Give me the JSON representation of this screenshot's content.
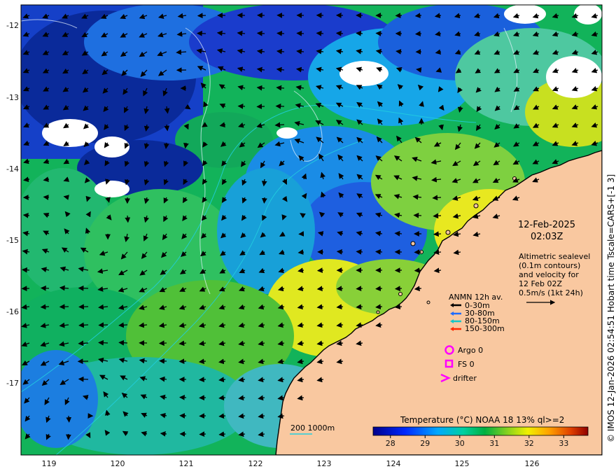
{
  "map": {
    "date": "12-Feb-2025",
    "time": "02:03Z",
    "side_credit": "© IMOS 12-Jan-2026 02:54:51 Hobart time Tscale=CARS+[-1 3]",
    "altimetry_note": [
      "Altimetric sealevel",
      "(0.1m contours)",
      "and velocity for",
      "12 Feb 02Z",
      "0.5m/s (1kt 24h)"
    ],
    "moorings": {
      "title": "ANMN 12h av.",
      "items": [
        {
          "label": "0-30m",
          "color": "#000000"
        },
        {
          "label": "30-80m",
          "color": "#1e6bff"
        },
        {
          "label": "80-150m",
          "color": "#14c8c8"
        },
        {
          "label": "150-300m",
          "color": "#ff2a00"
        }
      ]
    },
    "markers": [
      {
        "label": "Argo 0",
        "symbol": "circle-icon",
        "color": "#ff00ff"
      },
      {
        "label": "FS 0",
        "symbol": "square-icon",
        "color": "#ff00ff"
      },
      {
        "label": "drifter",
        "symbol": "chevron-icon",
        "color": "#ff00ff"
      }
    ],
    "isobath_label": "200  1000m",
    "isobath_color": "#22cfe0",
    "colorbar": {
      "title": "Temperature (°C) NOAA 18 13% ql>=2",
      "ticks": [
        "28",
        "29",
        "30",
        "31",
        "32",
        "33"
      ],
      "min": 27.5,
      "max": 33.7
    },
    "lon_ticks": [
      "119",
      "120",
      "121",
      "122",
      "123",
      "124",
      "125",
      "126"
    ],
    "lat_ticks": [
      "-12",
      "-13",
      "-14",
      "-15",
      "-16",
      "-17"
    ],
    "colors": {
      "land": "#f9c8a0",
      "coast": "#000000",
      "cloud": "#ffffff"
    }
  }
}
